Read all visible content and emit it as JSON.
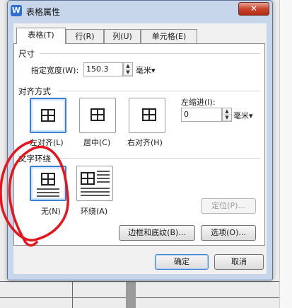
{
  "window": {
    "title": "表格属性",
    "app_icon": "W",
    "close_label": "✕"
  },
  "tabs": [
    {
      "label": "表格(T)"
    },
    {
      "label": "行(R)"
    },
    {
      "label": "列(U)"
    },
    {
      "label": "单元格(E)"
    }
  ],
  "size": {
    "section_label": "尺寸",
    "width_label": "指定宽度(W):",
    "width_value": "150.3",
    "unit": "毫米▾"
  },
  "alignment": {
    "section_label": "对齐方式",
    "options": [
      {
        "label": "左对齐(L)",
        "selected": true
      },
      {
        "label": "居中(C)",
        "selected": false
      },
      {
        "label": "右对齐(H)",
        "selected": false
      }
    ],
    "indent_label": "左缩进(I):",
    "indent_value": "0",
    "indent_unit": "毫米▾"
  },
  "wrapping": {
    "section_label": "文字环绕",
    "options": [
      {
        "label": "无(N)",
        "selected": true
      },
      {
        "label": "环绕(A)",
        "selected": false
      }
    ],
    "position_button": "定位(P)..."
  },
  "buttons": {
    "borders_shading": "边框和底纹(B)...",
    "options": "选项(O)...",
    "ok": "确定",
    "cancel": "取消"
  },
  "annotation": {
    "color": "#e8141b"
  }
}
